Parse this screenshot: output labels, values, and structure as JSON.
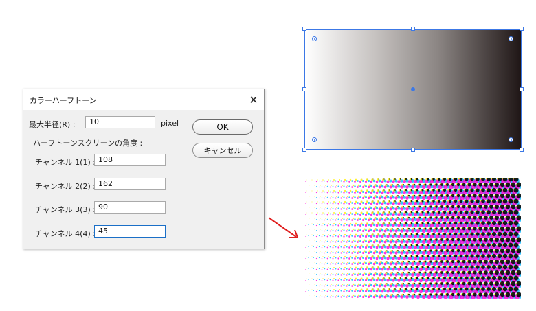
{
  "dialog": {
    "title": "カラーハーフトーン",
    "close_glyph": "✕",
    "max_radius_label": "最大半径(R) :",
    "max_radius_value": "10",
    "max_radius_unit": "pixel",
    "screen_angles_label": "ハーフトーンスクリーンの角度 :",
    "channels": [
      {
        "label": "チャンネル 1(1) :",
        "value": "108"
      },
      {
        "label": "チャンネル 2(2) :",
        "value": "162"
      },
      {
        "label": "チャンネル 3(3) :",
        "value": "90"
      },
      {
        "label": "チャンネル 4(4) :",
        "value": "45"
      }
    ],
    "ok_label": "OK",
    "cancel_label": "キャンセル"
  },
  "colors": {
    "selection": "#3c78e6",
    "arrow": "#e02020",
    "halftone_cyan": "#00b4ff",
    "halftone_magenta": "#ff00dc",
    "halftone_yellow": "#fff000",
    "halftone_black": "#000000"
  }
}
